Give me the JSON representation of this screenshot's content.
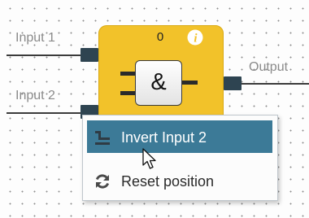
{
  "ports": {
    "input1_label": "Input 1",
    "input2_label": "Input 2",
    "output_label": "Output"
  },
  "block": {
    "counter": "0",
    "gate_symbol": "&",
    "info_icon": "info-icon",
    "color": "#f2c22a"
  },
  "context_menu": {
    "items": [
      {
        "label": "Invert Input 2",
        "icon": "invert-input-icon",
        "highlighted": true
      },
      {
        "label": "Reset position",
        "icon": "refresh-icon",
        "highlighted": false
      }
    ],
    "highlight_color": "#3c7a97"
  },
  "cursor": {
    "icon": "arrow-cursor-icon"
  }
}
